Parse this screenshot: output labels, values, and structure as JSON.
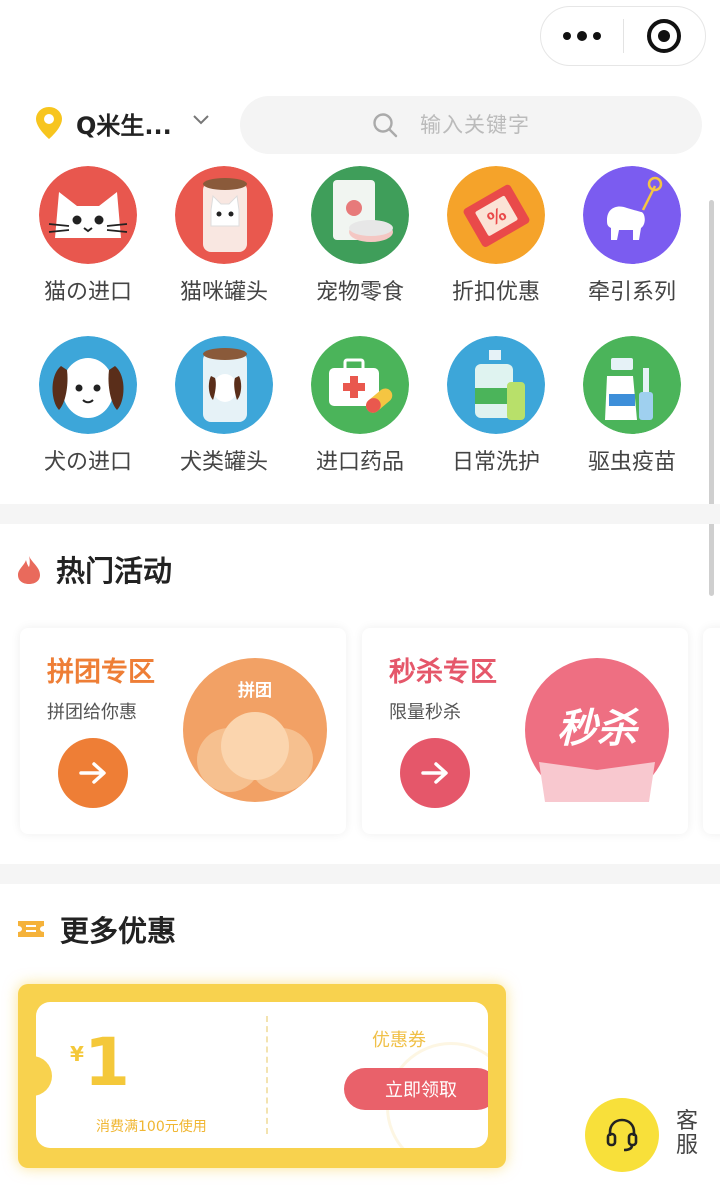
{
  "capsule": {
    "more_icon": "more-dots-icon",
    "close_icon": "target-close-icon"
  },
  "location": {
    "name": "Q米生...",
    "icon": "location-pin-icon"
  },
  "search": {
    "placeholder": "输入关键字",
    "icon": "search-icon"
  },
  "categories": [
    {
      "label": "猫の进口",
      "icon": "cat-face-icon"
    },
    {
      "label": "猫咪罐头",
      "icon": "cat-can-icon"
    },
    {
      "label": "宠物零食",
      "icon": "pet-snack-icon"
    },
    {
      "label": "折扣优惠",
      "icon": "discount-ticket-icon"
    },
    {
      "label": "牵引系列",
      "icon": "dog-leash-icon"
    },
    {
      "label": "犬の进口",
      "icon": "dog-face-icon"
    },
    {
      "label": "犬类罐头",
      "icon": "dog-can-icon"
    },
    {
      "label": "进口药品",
      "icon": "medicine-kit-icon"
    },
    {
      "label": "日常洗护",
      "icon": "shampoo-bottle-icon"
    },
    {
      "label": "驱虫疫苗",
      "icon": "spray-bottle-icon"
    }
  ],
  "hot": {
    "title": "热门活动",
    "cards": [
      {
        "title": "拼团专区",
        "subtitle": "拼团给你惠",
        "badge": "拼团",
        "color": "#ee7e36"
      },
      {
        "title": "秒杀专区",
        "subtitle": "限量秒杀",
        "badge": "秒杀",
        "color": "#e5576a"
      }
    ]
  },
  "more": {
    "title": "更多优惠",
    "coupon": {
      "currency": "¥",
      "amount": "1",
      "condition": "消费满100元使用",
      "type": "优惠券",
      "claim_label": "立即领取"
    }
  },
  "service": {
    "label": "客服",
    "icon": "headset-icon"
  },
  "colors": {
    "accent_yellow": "#f8d24e",
    "coupon_red": "#e9616a",
    "service_yellow": "#f8e03a"
  }
}
